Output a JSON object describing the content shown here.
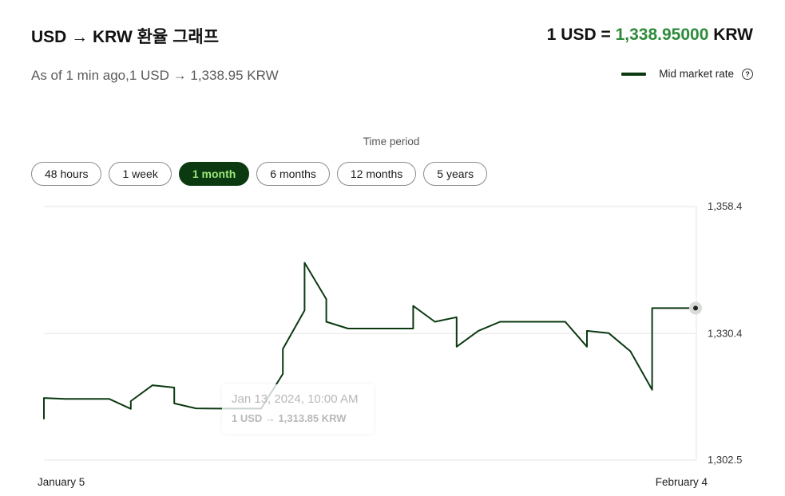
{
  "header": {
    "title": "USD → KRW 환율 그래프",
    "headline_prefix": "1 USD = ",
    "headline_rate": "1,338.95000",
    "headline_suffix": " KRW",
    "subtitle": "As of 1 min ago,1 USD → 1,338.95 KRW"
  },
  "legend": {
    "label": "Mid market rate",
    "help_icon": "question-circle-icon",
    "color": "#0b3a11"
  },
  "period": {
    "label": "Time period",
    "options": [
      "48 hours",
      "1 week",
      "1 month",
      "6 months",
      "12 months",
      "5 years"
    ],
    "selected": "1 month"
  },
  "tooltip": {
    "date": "Jan 13, 2024, 10:00 AM",
    "rate": "1 USD → 1,313.85 KRW"
  },
  "colors": {
    "line": "#0b3a11",
    "accent": "#2e8b3a",
    "active_button": "#0b3a11",
    "active_button_text": "#9ee67a"
  },
  "chart_data": {
    "type": "line",
    "series": [
      {
        "name": "Mid market rate",
        "x": [
          "2024-01-05",
          "2024-01-05",
          "2024-01-06",
          "2024-01-08",
          "2024-01-09",
          "2024-01-09",
          "2024-01-10",
          "2024-01-11",
          "2024-01-11",
          "2024-01-12",
          "2024-01-13",
          "2024-01-15",
          "2024-01-16",
          "2024-01-16",
          "2024-01-17",
          "2024-01-17",
          "2024-01-18",
          "2024-01-18",
          "2024-01-19",
          "2024-01-20",
          "2024-01-22",
          "2024-01-22",
          "2024-01-23",
          "2024-01-24",
          "2024-01-24",
          "2024-01-25",
          "2024-01-26",
          "2024-01-26",
          "2024-01-27",
          "2024-01-29",
          "2024-01-30",
          "2024-01-30",
          "2024-01-31",
          "2024-02-01",
          "2024-02-02",
          "2024-02-02",
          "2024-02-03",
          "2024-02-04"
        ],
        "y": [
          1311.5,
          1316.2,
          1316.0,
          1316.0,
          1313.8,
          1315.5,
          1319.0,
          1318.5,
          1315.0,
          1313.9,
          1313.85,
          1313.85,
          1321.5,
          1327.0,
          1335.5,
          1346.0,
          1338.0,
          1333.0,
          1331.5,
          1331.5,
          1331.5,
          1336.5,
          1333.0,
          1334.0,
          1327.5,
          1331.0,
          1333.0,
          1333.0,
          1333.0,
          1333.0,
          1327.5,
          1331.0,
          1330.5,
          1326.5,
          1318.0,
          1336.0,
          1336.0,
          1336.0
        ],
        "end_value": 1338.95
      }
    ],
    "x_tick_labels": [
      "January 5",
      "February 4"
    ],
    "y_tick_labels": [
      "1,358.4",
      "1,330.4",
      "1,302.5"
    ],
    "ylim": [
      1302.5,
      1358.4
    ],
    "grid": true,
    "legend_position": "top-right",
    "title": "USD → KRW 환율 그래프"
  }
}
